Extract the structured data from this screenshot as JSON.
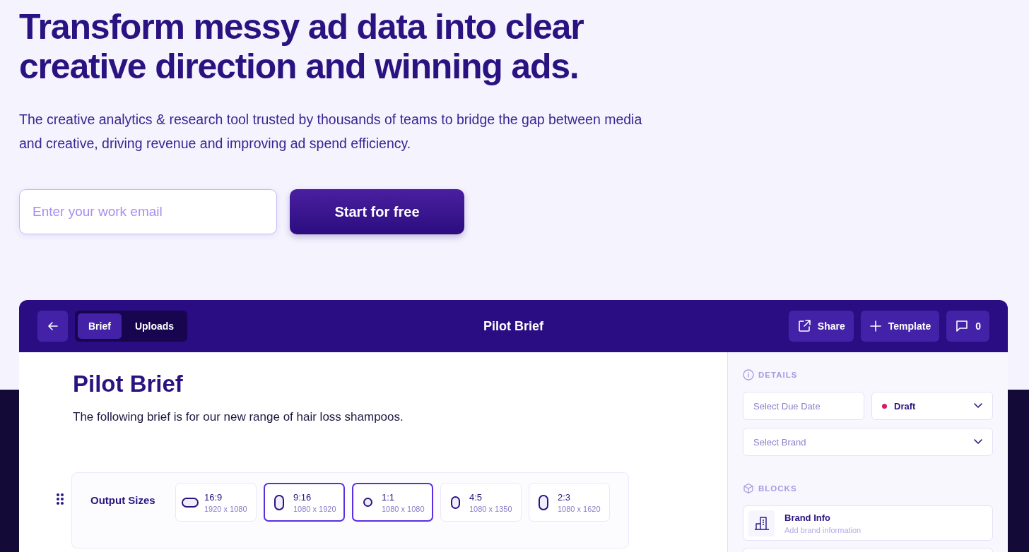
{
  "hero": {
    "heading": "Transform messy ad data into clear creative direction and winning ads.",
    "subheading": "The creative analytics & research tool trusted by thousands of teams to bridge the gap between media and creative, driving revenue and improving ad spend efficiency.",
    "email": {
      "placeholder": "Enter your work email"
    },
    "cta": "Start for free"
  },
  "app": {
    "header": {
      "tabs": [
        {
          "label": "Brief",
          "selected": true
        },
        {
          "label": "Uploads",
          "selected": false
        }
      ],
      "title": "Pilot Brief",
      "actions": [
        {
          "kind": "share",
          "label": "Share"
        },
        {
          "kind": "template",
          "label": "Template"
        },
        {
          "kind": "comments",
          "label": "0"
        }
      ]
    },
    "brief": {
      "title": "Pilot Brief",
      "description": "The following brief is for our new range of hair loss shampoos.",
      "output_sizes": {
        "label": "Output Sizes",
        "options": [
          {
            "ratio": "16:9",
            "dimensions": "1920 x 1080",
            "kind": "wide",
            "selected": false
          },
          {
            "ratio": "9:16",
            "dimensions": "1080 x 1920",
            "kind": "tall",
            "selected": true
          },
          {
            "ratio": "1:1",
            "dimensions": "1080 x 1080",
            "kind": "square",
            "selected": true
          },
          {
            "ratio": "4:5",
            "dimensions": "1080 x 1350",
            "kind": "portrait",
            "selected": false
          },
          {
            "ratio": "2:3",
            "dimensions": "1080 x 1620",
            "kind": "tall",
            "selected": false
          }
        ]
      }
    },
    "sidebar": {
      "details_heading": "DETAILS",
      "due_date": {
        "placeholder": "Select Due Date"
      },
      "status": {
        "label": "Draft",
        "color": "#d81b60"
      },
      "brand": {
        "placeholder": "Select Brand"
      },
      "blocks_heading": "BLOCKS",
      "blocks": [
        {
          "title": "Brand Info",
          "subtitle": "Add brand information"
        }
      ]
    }
  }
}
